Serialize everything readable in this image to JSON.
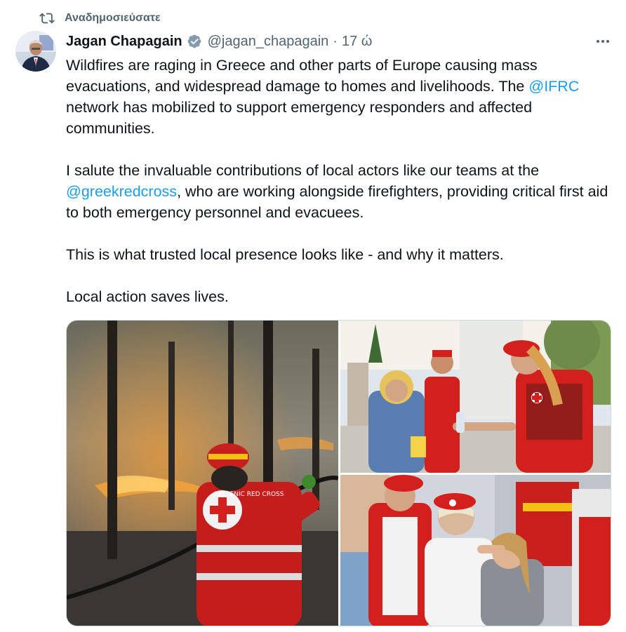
{
  "repost": {
    "label": "Αναδημοσιεύσατε",
    "icon": "repost-icon"
  },
  "tweet": {
    "author_name": "Jagan Chapagain",
    "handle": "@jagan_chapagain",
    "separator": "·",
    "time": "17 ώ",
    "verified_icon": "verified-badge-icon",
    "more_icon": "more-options-icon",
    "text": {
      "p1_a": "Wildfires are raging in Greece and other parts of Europe causing mass evacuations, and widespread damage to homes and livelihoods. The ",
      "p1_mention": "@IFRC",
      "p1_b": " network has mobilized to support emergency responders and affected communities.",
      "p2_a": "I salute the invaluable contributions of local actors like our teams at the ",
      "p2_mention": "@greekredcross",
      "p2_b": ", who are working alongside firefighters, providing critical first aid to both emergency personnel and evacuees.",
      "p3": "This is what trusted local presence looks like - and why it matters.",
      "p4": "Local action saves lives."
    },
    "media": {
      "image1": {
        "name": "firefighter-photo",
        "vest_text": "HELLENIC RED CROSS"
      },
      "image2": {
        "name": "volunteers-distributing-water-photo"
      },
      "image3": {
        "name": "first-aid-photo"
      }
    }
  },
  "colors": {
    "accent": "#1d9bf0",
    "secondary_text": "#536471",
    "red_cross": "#d3201c"
  }
}
